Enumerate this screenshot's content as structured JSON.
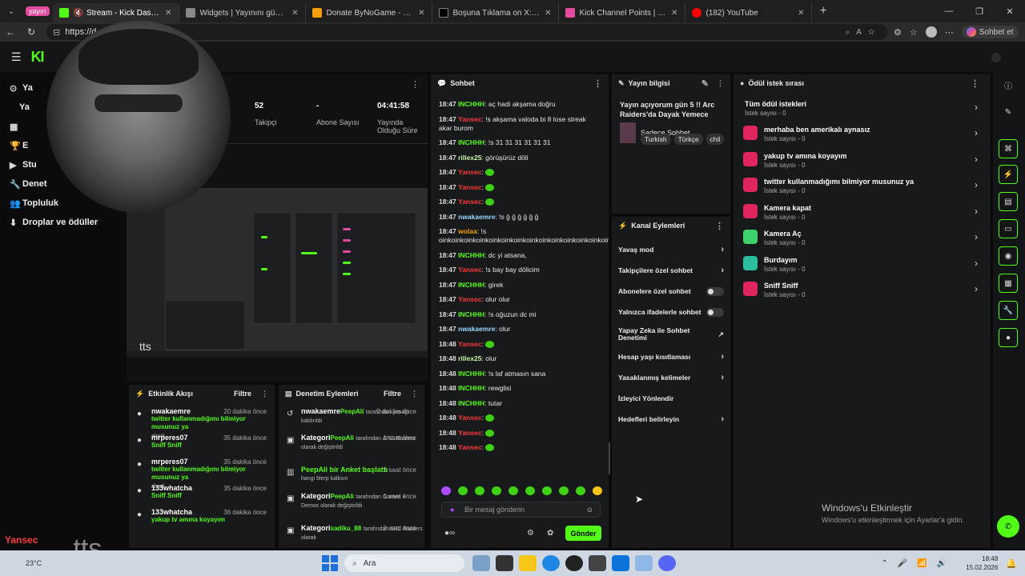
{
  "browser": {
    "group_label": "yayın",
    "tabs": [
      {
        "label": "Stream - Kick Dashboard",
        "color": "#53fc18"
      },
      {
        "label": "Widgets | Yayınını güçlendirmek i...",
        "color": "#aaaaaa"
      },
      {
        "label": "Donate ByNoGame - Gelen/Giden...",
        "color": "#f59e0b"
      },
      {
        "label": "Boşuna Tıklama on X: \"İzmir'de bir...",
        "color": "#ffffff"
      },
      {
        "label": "Kick Channel Points | Blerp",
        "color": "#e24ba0"
      },
      {
        "label": "(182) YouTube",
        "color": "#ff0000"
      }
    ],
    "url": "https://d",
    "copilot_label": "Sohbet et"
  },
  "sidebar": {
    "items": [
      {
        "label": "Ya",
        "icon": "live-icon"
      },
      {
        "label": "Ya",
        "icon": "none"
      },
      {
        "label": "",
        "icon": "dashboard-icon"
      },
      {
        "label": "E",
        "icon": "trophy-icon"
      },
      {
        "label": "Stu",
        "icon": "studio-icon"
      },
      {
        "label": "Denet",
        "icon": "wrench-icon"
      },
      {
        "label": "Topluluk",
        "icon": "community-icon"
      },
      {
        "label": "Droplar ve ödüller",
        "icon": "drops-icon"
      }
    ]
  },
  "stats": {
    "followers_value": "52",
    "followers_label": "Takipçi",
    "subs_value": "-",
    "subs_label": "Abone Sayısı",
    "uptime_value": "04:41:58",
    "uptime_label": "Yayında Olduğu Süre"
  },
  "activity": {
    "title": "Etkinlik Akışı",
    "filter": "Filtre",
    "items": [
      {
        "user": "nwakaemre",
        "time": "20 dakika önce",
        "reward": "twitter kullanmadığımı bilmiyor musunuz ya",
        "suffix": "alındı"
      },
      {
        "user": "mrperes07",
        "time": "35 dakika önce",
        "reward": "Sniff Sniff",
        "suffix": "alındı"
      },
      {
        "user": "mrperes07",
        "time": "35 dakika önce",
        "reward": "twitter kullanmadığımı bilmiyor musunuz ya",
        "suffix": "alındı"
      },
      {
        "user": "133whatcha",
        "time": "35 dakika önce",
        "reward": "Sniff Sniff",
        "suffix": "alındı"
      },
      {
        "user": "133whatcha",
        "time": "36 dakika önce",
        "reward": "yakup tv amına koyayım",
        "suffix": "alındı"
      }
    ]
  },
  "moderation": {
    "title": "Denetim Eylemleri",
    "filter": "Filtre",
    "items": [
      {
        "head": "nwakaemre",
        "time": "2 dakika önce",
        "actor": "PeepAli",
        "rest": "tarafından yasağı kaldırıldı",
        "icon": "undo-icon"
      },
      {
        "head": "Kategori",
        "time": "1 saat önce",
        "actor": "PeepAli",
        "rest": "tarafından ARC Raiders olarak değiştirildi",
        "icon": "category-icon"
      },
      {
        "head": "PeepAli bir Anket başlattı",
        "time": "1 saat önce",
        "actor": "",
        "rest": "hangi blerp kalksın",
        "icon": "poll-icon"
      },
      {
        "head": "Kategori",
        "time": "1 saat önce",
        "actor": "PeepAli",
        "rest": "tarafından Games + Demos olarak değiştirildi",
        "icon": "category-icon"
      },
      {
        "head": "Kategori",
        "time": "3 saat önce",
        "actor": "sadiku_88",
        "rest": "tarafından ARC Raiders olarak",
        "icon": "category-icon"
      }
    ]
  },
  "chat": {
    "title": "Sohbet",
    "messages": [
      {
        "time": "18:47",
        "user": "INCHHH",
        "color": "#53fc18",
        "text": "aç hadi akşama doğru"
      },
      {
        "time": "18:47",
        "user": "Yansec",
        "color": "#ff3b3b",
        "text": "!s akşama valoda bi 8 lose streak akar burom"
      },
      {
        "time": "18:47",
        "user": "INCHHH",
        "color": "#53fc18",
        "text": "!s 31 31 31 31 31 31"
      },
      {
        "time": "18:47",
        "user": "rillex25",
        "color": "#c8f7a6",
        "text": "görüşürüz döli"
      },
      {
        "time": "18:47",
        "user": "Yansec",
        "color": "#ff3b3b",
        "text": ""
      },
      {
        "time": "18:47",
        "user": "Yansec",
        "color": "#ff3b3b",
        "text": ""
      },
      {
        "time": "18:47",
        "user": "Yansec",
        "color": "#ff3b3b",
        "text": ""
      },
      {
        "time": "18:47",
        "user": "nwakaemre",
        "color": "#9ad8ff",
        "text": "!s ğ ğ ğ ğ ğ ğ"
      },
      {
        "time": "18:47",
        "user": "wolaa",
        "color": "#f59e0b",
        "text": "!s oinkoinkoinkoinkoinkoinkoinkoinkoinkoinkoinkoinkoinkoinkoinkoinkoinkoinkoinkoinkoinkoinkoinkoink"
      },
      {
        "time": "18:47",
        "user": "INCHHH",
        "color": "#53fc18",
        "text": "dc yi atsana,"
      },
      {
        "time": "18:47",
        "user": "Yansec",
        "color": "#ff3b3b",
        "text": "!s bay bay dölicim"
      },
      {
        "time": "18:47",
        "user": "INCHHH",
        "color": "#53fc18",
        "text": "girek"
      },
      {
        "time": "18:47",
        "user": "Yansec",
        "color": "#ff3b3b",
        "text": "olur olur"
      },
      {
        "time": "18:47",
        "user": "INCHHH",
        "color": "#53fc18",
        "text": "!s oğuzun dc mi"
      },
      {
        "time": "18:47",
        "user": "nwakaemre",
        "color": "#9ad8ff",
        "text": "olur"
      },
      {
        "time": "18:48",
        "user": "Yansec",
        "color": "#ff3b3b",
        "text": ""
      },
      {
        "time": "18:48",
        "user": "rillex25",
        "color": "#c8f7a6",
        "text": "olur"
      },
      {
        "time": "18:48",
        "user": "INCHHH",
        "color": "#53fc18",
        "text": "!s laf atmasın sana"
      },
      {
        "time": "18:48",
        "user": "INCHHH",
        "color": "#53fc18",
        "text": "rewglisi"
      },
      {
        "time": "18:48",
        "user": "INCHHH",
        "color": "#53fc18",
        "text": "tutar"
      },
      {
        "time": "18:48",
        "user": "Yansec",
        "color": "#ff3b3b",
        "text": ""
      },
      {
        "time": "18:48",
        "user": "Yansec",
        "color": "#ff3b3b",
        "text": ""
      },
      {
        "time": "18:48",
        "user": "Yansec",
        "color": "#ff3b3b",
        "text": ""
      }
    ],
    "placeholder": "Bir mesaj gönderin",
    "send_label": "Gönder"
  },
  "stream_info": {
    "title": "Yayın bilgisi",
    "stream_title": "Yayın açıyorum gün 5 !! Arc Raiders'da Dayak Yemece",
    "category": "Sadece Sohbet",
    "tags": [
      "Turkish",
      "Türkçe",
      "chil"
    ]
  },
  "channel_actions": {
    "title": "Kanal Eylemleri",
    "items": [
      {
        "label": "Yavaş mod",
        "kind": "arrow"
      },
      {
        "label": "Takipçilere özel sohbet",
        "kind": "arrow"
      },
      {
        "label": "Abonelere özel sohbet",
        "kind": "toggle"
      },
      {
        "label": "Yalnızca ifadelerle sohbet",
        "kind": "toggle"
      },
      {
        "label": "Yapay Zeka ile Sohbet Denetimi",
        "kind": "external"
      },
      {
        "label": "Hesap yaşı kısıtlaması",
        "kind": "arrow"
      },
      {
        "label": "Yasaklanmış kelimeler",
        "kind": "arrow"
      },
      {
        "label": "İzleyici Yönlendir",
        "kind": "none"
      },
      {
        "label": "Hedefleri belirleyin",
        "kind": "arrow"
      }
    ]
  },
  "rewards": {
    "title": "Ödül istek sırası",
    "all_label": "Tüm ödül istekleri",
    "all_count": "İstek sayısı - 0",
    "items": [
      {
        "label": "merhaba ben amerikalı aynasız",
        "count": "İstek sayısı - 0",
        "color": "#e0245e"
      },
      {
        "label": "yakup tv amına koyayım",
        "count": "İstek sayısı - 0",
        "color": "#e0245e"
      },
      {
        "label": "twitter kullanmadığımı bilmiyor musunuz ya",
        "count": "İstek sayısı - 0",
        "color": "#e0245e"
      },
      {
        "label": "Kamera kapat",
        "count": "İstek sayısı - 0",
        "color": "#e0245e"
      },
      {
        "label": "Kamera Aç",
        "count": "İstek sayısı - 0",
        "color": "#3fd16b"
      },
      {
        "label": "Burdayım",
        "count": "İstek sayısı - 0",
        "color": "#2bbfa0"
      },
      {
        "label": "Sniff Sniff",
        "count": "İstek sayısı - 0",
        "color": "#e0245e"
      }
    ]
  },
  "windows": {
    "activate_title": "Windows'u Etkinleştir",
    "activate_sub": "Windows'u etkinleştirmek için Ayarlar'a gidin."
  },
  "overlay": {
    "name": "Yansec",
    "tts": "tts",
    "temp": "23°C"
  },
  "taskbar": {
    "search": "Ara",
    "time": "18:48",
    "date": "15.02.2026"
  },
  "colors": {
    "accent": "#53fc18",
    "panel": "#18191b"
  }
}
